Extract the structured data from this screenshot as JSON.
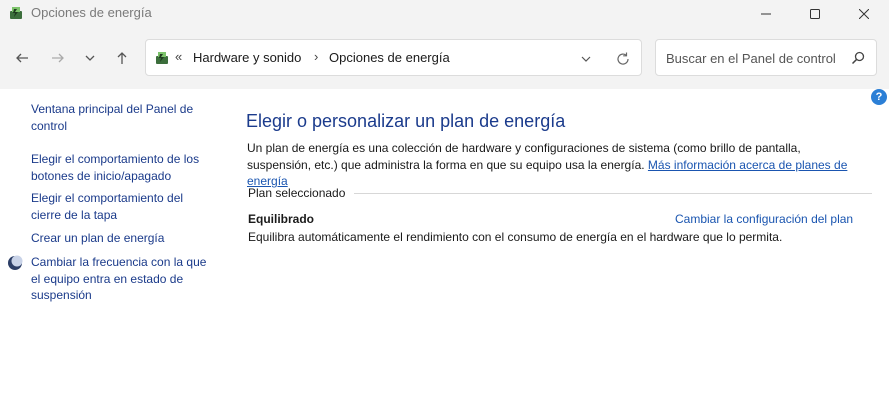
{
  "window": {
    "title": "Opciones de energía",
    "app_icon": "power-options-icon"
  },
  "nav": {
    "back_icon": "arrow-left-icon",
    "forward_icon": "arrow-right-icon",
    "recent_icon": "chevron-down-icon",
    "up_icon": "arrow-up-icon"
  },
  "address": {
    "overflow": "«",
    "crumbs": [
      "Hardware y sonido",
      "Opciones de energía"
    ],
    "separator": "›"
  },
  "search": {
    "placeholder": "Buscar en el Panel de control"
  },
  "sidebar": {
    "items": [
      {
        "label": "Ventana principal del Panel de control"
      },
      {
        "label": "Elegir el comportamiento de los botones de inicio/apagado"
      },
      {
        "label": "Elegir el comportamiento del cierre de la tapa"
      },
      {
        "label": "Crear un plan de energía"
      },
      {
        "label": "Cambiar la frecuencia con la que el equipo entra en estado de suspensión",
        "icon": "moon-icon"
      }
    ]
  },
  "main": {
    "title": "Elegir o personalizar un plan de energía",
    "description": "Un plan de energía es una colección de hardware y configuraciones de sistema (como brillo de pantalla, suspensión, etc.) que administra la forma en que su equipo usa la energía.",
    "more_info_link": "Más información acerca de planes de energía",
    "section_label": "Plan seleccionado",
    "plan": {
      "name": "Equilibrado",
      "change_link": "Cambiar la configuración del plan",
      "description": "Equilibra automáticamente el rendimiento con el consumo de energía en el hardware que lo permita."
    }
  },
  "help_label": "?",
  "colors": {
    "link": "#1a55b0",
    "sidebar_link": "#1a3a8a",
    "title": "#1b3b8c",
    "chrome": "#f3f3f3"
  }
}
